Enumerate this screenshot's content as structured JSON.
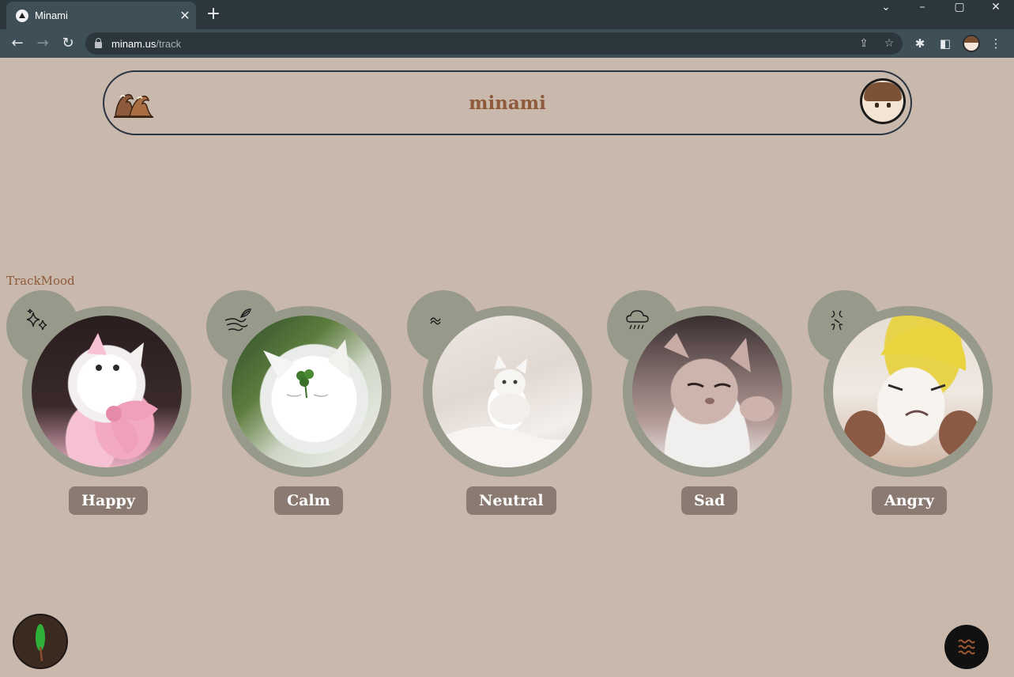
{
  "browser": {
    "tab_title": "Minami",
    "url_host": "minam.us",
    "url_path": "/track",
    "icons": [
      "favicon-icon",
      "close-tab-icon",
      "new-tab-icon",
      "tab-search-icon",
      "minimize-icon",
      "maximize-icon",
      "close-window-icon",
      "back-icon",
      "forward-icon",
      "reload-icon",
      "lock-icon",
      "share-icon",
      "star-icon",
      "extensions-icon",
      "side-panel-icon",
      "profile-avatar",
      "menu-icon"
    ]
  },
  "header": {
    "site_name": "minami",
    "logo_icon": "wave-icon",
    "avatar_icon": "profile-avatar"
  },
  "section": {
    "title": "TrackMood"
  },
  "moods": [
    {
      "label": "Happy",
      "icon": "sparkles-icon"
    },
    {
      "label": "Calm",
      "icon": "wind-leaf-icon"
    },
    {
      "label": "Neutral",
      "icon": "tilde-icon"
    },
    {
      "label": "Sad",
      "icon": "rain-cloud-icon"
    },
    {
      "label": "Angry",
      "icon": "anger-icon"
    }
  ],
  "fabs": {
    "left_icon": "leaf-icon",
    "right_icon": "waves-icon"
  },
  "colors": {
    "background": "#c9b8ac",
    "accent_brown": "#8d5a3b",
    "ring_sage": "#979a8b",
    "label_bg": "#8b7a72",
    "header_border": "#2a3440"
  }
}
